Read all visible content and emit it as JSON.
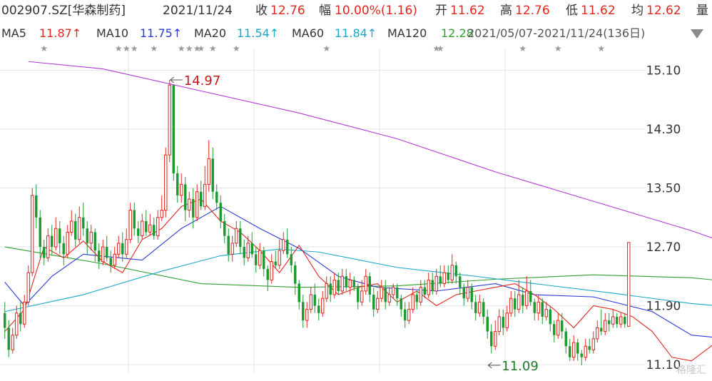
{
  "header": {
    "code": "002907.SZ[华森制药]",
    "date": "2021/11/24",
    "close_label": "收",
    "close_value": "12.76",
    "change_label": "幅",
    "change_value": "10.00%(1.16)",
    "open_label": "开",
    "open_value": "11.62",
    "high_label": "高",
    "high_value": "12.76",
    "low_label": "低",
    "low_value": "11.62",
    "avg_label": "均",
    "avg_value": "12.62",
    "volume_label": "量"
  },
  "ma_bar": {
    "ma5_label": "MA5",
    "ma5_value": "11.87↑",
    "ma10_label": "MA10",
    "ma10_value": "11.75↑",
    "ma20_label": "MA20",
    "ma20_value": "11.54↑",
    "ma60_label": "MA60",
    "ma60_value": "11.84↑",
    "ma120_label": "MA120",
    "ma120_value": "12.28",
    "overlap_text": "2021/05/07-2021/11/24(136日)",
    "dropdown_icon": "triangle-down-icon"
  },
  "colors": {
    "up": "#e0261d",
    "down": "#1c9a2f",
    "ma5": "#e0261d",
    "ma10": "#2a3bd2",
    "ma20": "#1aa6c9",
    "ma60": "#2fa02f",
    "ma120": "#b03ad6",
    "grid": "#e3e3e3"
  },
  "chart_data": {
    "type": "candlestick",
    "ylim": [
      11.09,
      15.3
    ],
    "ytick_labels": [
      "15.10",
      "14.30",
      "13.50",
      "12.70",
      "11.90",
      "11.10"
    ],
    "ytick_values": [
      15.1,
      14.3,
      13.5,
      12.7,
      11.9,
      11.1
    ],
    "annotations": [
      {
        "text": "14.97",
        "bar_index": 42,
        "value": 14.97
      },
      {
        "text": "11.09",
        "bar_index": 123,
        "value": 11.09
      }
    ],
    "event_marker_bars": [
      10,
      29,
      31,
      33,
      38,
      45,
      47,
      49,
      50,
      53,
      59,
      82,
      110,
      111,
      132,
      141,
      152
    ],
    "ma_lines": [
      {
        "name": "MA120",
        "points": [
          [
            6,
            15.22
          ],
          [
            25,
            15.12
          ],
          [
            50,
            14.82
          ],
          [
            75,
            14.52
          ],
          [
            100,
            14.17
          ],
          [
            125,
            13.72
          ],
          [
            150,
            13.32
          ],
          [
            175,
            12.92
          ],
          [
            190,
            12.64
          ],
          [
            200,
            12.55
          ]
        ]
      },
      {
        "name": "MA60",
        "points": [
          [
            0,
            12.7
          ],
          [
            25,
            12.47
          ],
          [
            50,
            12.2
          ],
          [
            75,
            12.15
          ],
          [
            100,
            12.17
          ],
          [
            125,
            12.26
          ],
          [
            150,
            12.32
          ],
          [
            175,
            12.28
          ],
          [
            200,
            12.15
          ]
        ]
      },
      {
        "name": "MA20",
        "points": [
          [
            0,
            11.82
          ],
          [
            20,
            12.05
          ],
          [
            40,
            12.37
          ],
          [
            55,
            12.58
          ],
          [
            70,
            12.67
          ],
          [
            80,
            12.63
          ],
          [
            100,
            12.42
          ],
          [
            120,
            12.3
          ],
          [
            135,
            12.2
          ],
          [
            155,
            12.07
          ],
          [
            175,
            11.93
          ],
          [
            190,
            11.86
          ],
          [
            200,
            11.84
          ]
        ]
      },
      {
        "name": "MA10",
        "points": [
          [
            0,
            12.22
          ],
          [
            5,
            11.9
          ],
          [
            12,
            12.3
          ],
          [
            20,
            12.6
          ],
          [
            35,
            12.52
          ],
          [
            45,
            12.95
          ],
          [
            55,
            13.25
          ],
          [
            65,
            12.95
          ],
          [
            75,
            12.68
          ],
          [
            85,
            12.3
          ],
          [
            95,
            12.15
          ],
          [
            110,
            12.1
          ],
          [
            125,
            12.2
          ],
          [
            135,
            12.05
          ],
          [
            150,
            12.02
          ],
          [
            165,
            11.82
          ],
          [
            175,
            11.5
          ],
          [
            185,
            11.45
          ],
          [
            195,
            11.58
          ],
          [
            200,
            11.75
          ]
        ]
      },
      {
        "name": "MA5",
        "points": [
          [
            0,
            11.55
          ],
          [
            5,
            11.85
          ],
          [
            10,
            12.7
          ],
          [
            15,
            12.55
          ],
          [
            20,
            12.78
          ],
          [
            25,
            12.5
          ],
          [
            30,
            12.35
          ],
          [
            35,
            12.8
          ],
          [
            40,
            12.95
          ],
          [
            45,
            13.25
          ],
          [
            50,
            13.35
          ],
          [
            55,
            13.05
          ],
          [
            60,
            12.9
          ],
          [
            65,
            12.65
          ],
          [
            70,
            12.35
          ],
          [
            75,
            12.72
          ],
          [
            80,
            12.3
          ],
          [
            85,
            12.05
          ],
          [
            90,
            12.15
          ],
          [
            95,
            12.2
          ],
          [
            100,
            11.95
          ],
          [
            105,
            12.1
          ],
          [
            110,
            11.9
          ],
          [
            115,
            12.05
          ],
          [
            120,
            12.1
          ],
          [
            125,
            12.15
          ],
          [
            130,
            12.2
          ],
          [
            135,
            12.05
          ],
          [
            140,
            11.85
          ],
          [
            145,
            11.6
          ],
          [
            150,
            11.9
          ],
          [
            155,
            11.85
          ],
          [
            160,
            11.75
          ],
          [
            165,
            11.55
          ],
          [
            170,
            11.2
          ],
          [
            175,
            11.15
          ],
          [
            180,
            11.35
          ],
          [
            185,
            11.55
          ],
          [
            190,
            11.62
          ],
          [
            195,
            11.65
          ],
          [
            200,
            11.87
          ]
        ]
      }
    ],
    "candles": [
      [
        11.8,
        11.6,
        11.95,
        11.45
      ],
      [
        11.6,
        11.3,
        11.7,
        11.2
      ],
      [
        11.3,
        11.5,
        11.6,
        11.25
      ],
      [
        11.5,
        11.8,
        11.9,
        11.45
      ],
      [
        11.8,
        11.65,
        11.95,
        11.55
      ],
      [
        11.65,
        11.95,
        12.05,
        11.6
      ],
      [
        11.95,
        12.35,
        12.45,
        11.9
      ],
      [
        12.35,
        13.4,
        13.5,
        12.3
      ],
      [
        13.4,
        13.1,
        13.55,
        12.95
      ],
      [
        13.1,
        12.7,
        13.2,
        12.55
      ],
      [
        12.7,
        12.55,
        12.8,
        12.45
      ],
      [
        12.55,
        12.85,
        12.95,
        12.5
      ],
      [
        12.85,
        12.7,
        13.0,
        12.6
      ],
      [
        12.7,
        12.95,
        13.1,
        12.65
      ],
      [
        12.95,
        12.75,
        13.05,
        12.6
      ],
      [
        12.75,
        12.6,
        12.85,
        12.45
      ],
      [
        12.6,
        12.9,
        13.0,
        12.55
      ],
      [
        12.9,
        13.05,
        13.2,
        12.85
      ],
      [
        13.05,
        12.8,
        13.15,
        12.7
      ],
      [
        12.8,
        13.1,
        13.25,
        12.75
      ],
      [
        13.1,
        12.95,
        13.3,
        12.85
      ],
      [
        12.95,
        12.75,
        13.05,
        12.6
      ],
      [
        12.75,
        12.9,
        13.0,
        12.65
      ],
      [
        12.9,
        12.65,
        12.95,
        12.5
      ],
      [
        12.65,
        12.5,
        12.75,
        12.4
      ],
      [
        12.5,
        12.7,
        12.8,
        12.45
      ],
      [
        12.7,
        12.55,
        12.85,
        12.5
      ],
      [
        12.55,
        12.45,
        12.65,
        12.35
      ],
      [
        12.45,
        12.6,
        12.7,
        12.4
      ],
      [
        12.6,
        12.75,
        12.85,
        12.55
      ],
      [
        12.75,
        12.6,
        12.9,
        12.5
      ],
      [
        12.6,
        12.8,
        12.95,
        12.55
      ],
      [
        12.8,
        13.2,
        13.3,
        12.75
      ],
      [
        13.2,
        12.95,
        13.3,
        12.85
      ],
      [
        12.95,
        12.85,
        13.05,
        12.75
      ],
      [
        12.85,
        13.05,
        13.15,
        12.8
      ],
      [
        13.05,
        12.9,
        13.2,
        12.85
      ],
      [
        12.9,
        13.0,
        13.15,
        12.85
      ],
      [
        13.0,
        12.85,
        13.1,
        12.8
      ],
      [
        12.85,
        13.1,
        13.2,
        12.8
      ],
      [
        13.1,
        13.2,
        13.4,
        13.05
      ],
      [
        13.2,
        13.95,
        14.05,
        13.1
      ],
      [
        13.95,
        14.9,
        14.97,
        13.85
      ],
      [
        14.9,
        13.7,
        14.9,
        13.6
      ],
      [
        13.7,
        13.4,
        13.8,
        13.3
      ],
      [
        13.4,
        13.55,
        13.7,
        13.3
      ],
      [
        13.55,
        13.2,
        13.65,
        13.05
      ],
      [
        13.2,
        13.35,
        13.45,
        13.1
      ],
      [
        13.35,
        13.1,
        13.5,
        12.95
      ],
      [
        13.1,
        13.45,
        13.55,
        13.05
      ],
      [
        13.45,
        13.25,
        13.6,
        13.2
      ],
      [
        13.25,
        13.55,
        13.8,
        13.2
      ],
      [
        13.55,
        13.9,
        14.15,
        13.45
      ],
      [
        13.9,
        13.45,
        14.05,
        13.35
      ],
      [
        13.45,
        13.3,
        13.55,
        13.2
      ],
      [
        13.3,
        13.05,
        13.4,
        12.95
      ],
      [
        13.05,
        12.85,
        13.15,
        12.75
      ],
      [
        12.85,
        12.6,
        12.95,
        12.5
      ],
      [
        12.6,
        12.75,
        12.85,
        12.5
      ],
      [
        12.75,
        12.95,
        13.05,
        12.7
      ],
      [
        12.95,
        12.7,
        13.05,
        12.6
      ],
      [
        12.7,
        12.55,
        12.8,
        12.45
      ],
      [
        12.55,
        12.75,
        12.85,
        12.5
      ],
      [
        12.75,
        12.6,
        12.9,
        12.55
      ],
      [
        12.6,
        12.45,
        12.7,
        12.35
      ],
      [
        12.45,
        12.65,
        12.75,
        12.4
      ],
      [
        12.65,
        12.4,
        12.7,
        12.3
      ],
      [
        12.4,
        12.25,
        12.45,
        12.1
      ],
      [
        12.25,
        12.5,
        12.6,
        12.2
      ],
      [
        12.5,
        12.45,
        12.65,
        12.4
      ],
      [
        12.45,
        12.65,
        12.8,
        12.4
      ],
      [
        12.65,
        12.8,
        12.9,
        12.6
      ],
      [
        12.8,
        12.6,
        12.95,
        12.55
      ],
      [
        12.6,
        12.45,
        12.7,
        12.35
      ],
      [
        12.45,
        12.2,
        12.5,
        12.05
      ],
      [
        12.2,
        11.95,
        12.25,
        11.85
      ],
      [
        11.95,
        11.7,
        12.05,
        11.6
      ],
      [
        11.7,
        11.85,
        11.95,
        11.6
      ],
      [
        11.85,
        12.05,
        12.15,
        11.8
      ],
      [
        12.05,
        11.9,
        12.2,
        11.8
      ],
      [
        11.9,
        11.8,
        12.0,
        11.7
      ],
      [
        11.8,
        12.0,
        12.1,
        11.75
      ],
      [
        12.0,
        12.2,
        12.3,
        11.95
      ],
      [
        12.2,
        12.05,
        12.3,
        11.95
      ],
      [
        12.05,
        12.25,
        12.35,
        12.0
      ],
      [
        12.25,
        12.1,
        12.35,
        12.05
      ],
      [
        12.1,
        12.3,
        12.4,
        12.05
      ],
      [
        12.3,
        12.15,
        12.4,
        12.1
      ],
      [
        12.15,
        12.25,
        12.35,
        12.05
      ],
      [
        12.25,
        12.15,
        12.3,
        12.1
      ],
      [
        12.15,
        11.95,
        12.2,
        11.85
      ],
      [
        11.95,
        12.1,
        12.25,
        11.9
      ],
      [
        12.1,
        12.3,
        12.4,
        12.05
      ],
      [
        12.3,
        12.05,
        12.35,
        11.95
      ],
      [
        12.05,
        11.85,
        12.15,
        11.75
      ],
      [
        11.85,
        12.0,
        12.1,
        11.8
      ],
      [
        12.0,
        12.15,
        12.25,
        11.95
      ],
      [
        12.15,
        11.95,
        12.25,
        11.85
      ],
      [
        11.95,
        12.05,
        12.15,
        11.9
      ],
      [
        12.05,
        12.15,
        12.2,
        12.0
      ],
      [
        12.15,
        12.0,
        12.2,
        11.9
      ],
      [
        12.0,
        11.85,
        12.05,
        11.75
      ],
      [
        11.85,
        11.7,
        11.95,
        11.6
      ],
      [
        11.7,
        11.85,
        11.95,
        11.65
      ],
      [
        11.85,
        12.05,
        12.15,
        11.8
      ],
      [
        12.05,
        11.95,
        12.1,
        11.85
      ],
      [
        11.95,
        12.15,
        12.25,
        11.9
      ],
      [
        12.15,
        12.05,
        12.25,
        12.0
      ],
      [
        12.05,
        12.25,
        12.35,
        12.0
      ],
      [
        12.25,
        12.1,
        12.35,
        12.05
      ],
      [
        12.1,
        12.3,
        12.4,
        12.05
      ],
      [
        12.3,
        12.2,
        12.45,
        12.15
      ],
      [
        12.2,
        12.35,
        12.45,
        12.15
      ],
      [
        12.35,
        12.25,
        12.45,
        12.2
      ],
      [
        12.25,
        12.45,
        12.6,
        12.2
      ],
      [
        12.45,
        12.3,
        12.5,
        12.2
      ],
      [
        12.3,
        12.15,
        12.35,
        12.05
      ],
      [
        12.15,
        12.0,
        12.2,
        11.9
      ],
      [
        12.0,
        12.15,
        12.25,
        11.95
      ],
      [
        12.15,
        11.95,
        12.2,
        11.85
      ],
      [
        11.95,
        11.8,
        12.05,
        11.7
      ],
      [
        11.8,
        11.95,
        12.05,
        11.75
      ],
      [
        11.95,
        11.75,
        12.0,
        11.65
      ],
      [
        11.75,
        11.55,
        11.85,
        11.45
      ],
      [
        11.55,
        11.35,
        11.65,
        11.25
      ],
      [
        11.35,
        11.55,
        11.7,
        11.3
      ],
      [
        11.55,
        11.75,
        11.85,
        11.5
      ],
      [
        11.75,
        11.6,
        11.85,
        11.5
      ],
      [
        11.6,
        11.8,
        11.9,
        11.55
      ],
      [
        11.8,
        12.0,
        12.1,
        11.75
      ],
      [
        12.0,
        11.85,
        12.1,
        11.75
      ],
      [
        11.85,
        12.05,
        12.25,
        11.8
      ],
      [
        12.05,
        11.9,
        12.15,
        11.8
      ],
      [
        11.9,
        12.1,
        12.3,
        11.85
      ],
      [
        12.1,
        11.95,
        12.25,
        11.9
      ],
      [
        11.95,
        11.8,
        12.0,
        11.7
      ],
      [
        11.8,
        11.95,
        12.05,
        11.7
      ],
      [
        11.95,
        11.75,
        12.0,
        11.65
      ],
      [
        11.75,
        11.85,
        11.95,
        11.7
      ],
      [
        11.85,
        11.65,
        11.9,
        11.55
      ],
      [
        11.65,
        11.5,
        11.7,
        11.4
      ],
      [
        11.5,
        11.7,
        11.8,
        11.45
      ],
      [
        11.7,
        11.55,
        11.8,
        11.45
      ],
      [
        11.55,
        11.35,
        11.6,
        11.25
      ],
      [
        11.35,
        11.2,
        11.45,
        11.15
      ],
      [
        11.2,
        11.4,
        11.5,
        11.15
      ],
      [
        11.4,
        11.25,
        11.45,
        11.15
      ],
      [
        11.25,
        11.2,
        11.3,
        11.09
      ],
      [
        11.2,
        11.35,
        11.45,
        11.15
      ],
      [
        11.35,
        11.3,
        11.45,
        11.25
      ],
      [
        11.3,
        11.45,
        11.55,
        11.25
      ],
      [
        11.45,
        11.6,
        11.7,
        11.4
      ],
      [
        11.6,
        11.55,
        11.85,
        11.5
      ],
      [
        11.55,
        11.7,
        11.8,
        11.5
      ],
      [
        11.7,
        11.65,
        11.8,
        11.55
      ],
      [
        11.65,
        11.75,
        11.85,
        11.6
      ],
      [
        11.75,
        11.65,
        11.8,
        11.6
      ],
      [
        11.65,
        11.75,
        11.8,
        11.6
      ],
      [
        11.75,
        11.65,
        11.8,
        11.6
      ],
      [
        11.62,
        12.76,
        12.76,
        11.62
      ]
    ]
  },
  "watermark": "格隆汇"
}
